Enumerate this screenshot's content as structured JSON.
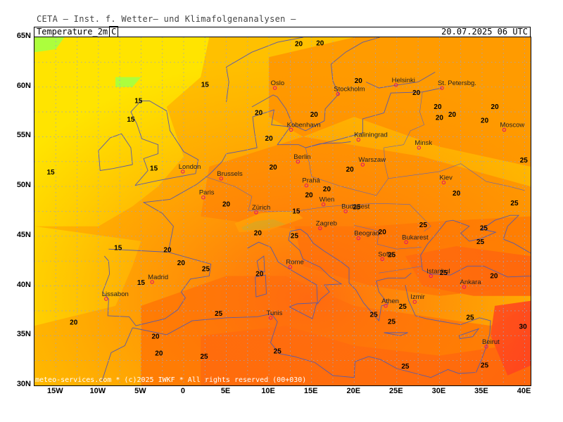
{
  "top_title": "CETA — Inst. f. Wetter— und Klimafolgenanalysen —",
  "header": {
    "field": "Temperature_2m",
    "unit": "C",
    "datetime": "20.07.2025 06 UTC"
  },
  "credit": "meteo-services.com * (c)2025 IWKF * All rights reserved (00+030)",
  "lat_labels": [
    "65N",
    "60N",
    "55N",
    "50N",
    "45N",
    "40N",
    "35N",
    "30N"
  ],
  "lon_labels": [
    "15W",
    "10W",
    "5W",
    "0",
    "5E",
    "10E",
    "15E",
    "20E",
    "25E",
    "30E",
    "35E",
    "40E"
  ],
  "colors": {
    "cool": "#ffe600",
    "mild": "#ffc000",
    "warm": "#ff9900",
    "hot": "#ff7a00",
    "hotter": "#ff5a10",
    "very_hot": "#ff2a2a",
    "green": "#a8ff40"
  },
  "cities": [
    {
      "name": "Oslo",
      "lon": 10.7,
      "lat": 59.9
    },
    {
      "name": "Stockholm",
      "lon": 18.1,
      "lat": 59.3
    },
    {
      "name": "Helsinki",
      "lon": 24.9,
      "lat": 60.2
    },
    {
      "name": "St. Petersbg.",
      "lon": 30.3,
      "lat": 59.9
    },
    {
      "name": "Kobenhavn",
      "lon": 12.6,
      "lat": 55.7
    },
    {
      "name": "Kaliningrad",
      "lon": 20.5,
      "lat": 54.7
    },
    {
      "name": "Minsk",
      "lon": 27.6,
      "lat": 53.9
    },
    {
      "name": "Moscow",
      "lon": 37.6,
      "lat": 55.7
    },
    {
      "name": "London",
      "lon": -0.1,
      "lat": 51.5
    },
    {
      "name": "Brussels",
      "lon": 4.4,
      "lat": 50.8
    },
    {
      "name": "Berlin",
      "lon": 13.4,
      "lat": 52.5
    },
    {
      "name": "Warszaw",
      "lon": 21.0,
      "lat": 52.2
    },
    {
      "name": "Paris",
      "lon": 2.3,
      "lat": 48.9
    },
    {
      "name": "Prahá",
      "lon": 14.4,
      "lat": 50.1
    },
    {
      "name": "Kiev",
      "lon": 30.5,
      "lat": 50.4
    },
    {
      "name": "Wien",
      "lon": 16.4,
      "lat": 48.2
    },
    {
      "name": "Zürich",
      "lon": 8.5,
      "lat": 47.4
    },
    {
      "name": "Budapest",
      "lon": 19.0,
      "lat": 47.5
    },
    {
      "name": "Zagreb",
      "lon": 16.0,
      "lat": 45.8
    },
    {
      "name": "Beograd",
      "lon": 20.5,
      "lat": 44.8
    },
    {
      "name": "Bukarest",
      "lon": 26.1,
      "lat": 44.4
    },
    {
      "name": "Sofia",
      "lon": 23.3,
      "lat": 42.7
    },
    {
      "name": "Rome",
      "lon": 12.5,
      "lat": 41.9
    },
    {
      "name": "Madrid",
      "lon": -3.7,
      "lat": 40.4
    },
    {
      "name": "Lissabon",
      "lon": -9.1,
      "lat": 38.7
    },
    {
      "name": "Istanbul",
      "lon": 29.0,
      "lat": 41.0
    },
    {
      "name": "Ankara",
      "lon": 32.9,
      "lat": 39.9
    },
    {
      "name": "Athen",
      "lon": 23.7,
      "lat": 38.0
    },
    {
      "name": "Izmir",
      "lon": 27.1,
      "lat": 38.4
    },
    {
      "name": "Tunis",
      "lon": 10.2,
      "lat": 36.8
    },
    {
      "name": "Beirut",
      "lon": 35.5,
      "lat": 33.9
    }
  ],
  "contour_labels": [
    {
      "text": "20",
      "lon": 13.5,
      "lat": 64.1
    },
    {
      "text": "20",
      "lon": 16.0,
      "lat": 64.2
    },
    {
      "text": "15",
      "lon": 2.5,
      "lat": 60.0
    },
    {
      "text": "20",
      "lon": 20.5,
      "lat": 60.4
    },
    {
      "text": "20",
      "lon": 27.3,
      "lat": 59.2
    },
    {
      "text": "20",
      "lon": 29.8,
      "lat": 57.8
    },
    {
      "text": "20",
      "lon": 31.5,
      "lat": 57.0
    },
    {
      "text": "20",
      "lon": 36.5,
      "lat": 57.8
    },
    {
      "text": "15",
      "lon": -5.3,
      "lat": 58.4
    },
    {
      "text": "15",
      "lon": -6.2,
      "lat": 56.5
    },
    {
      "text": "20",
      "lon": 8.8,
      "lat": 57.2
    },
    {
      "text": "20",
      "lon": 15.3,
      "lat": 57.0
    },
    {
      "text": "20",
      "lon": 10.0,
      "lat": 54.6
    },
    {
      "text": "20",
      "lon": 30.0,
      "lat": 56.7
    },
    {
      "text": "20",
      "lon": 35.3,
      "lat": 56.4
    },
    {
      "text": "25",
      "lon": 39.9,
      "lat": 52.4
    },
    {
      "text": "15",
      "lon": -15.6,
      "lat": 51.2
    },
    {
      "text": "15",
      "lon": -3.5,
      "lat": 51.6
    },
    {
      "text": "20",
      "lon": 10.5,
      "lat": 51.7
    },
    {
      "text": "20",
      "lon": 19.5,
      "lat": 51.5
    },
    {
      "text": "20",
      "lon": 16.8,
      "lat": 49.5
    },
    {
      "text": "20",
      "lon": 14.7,
      "lat": 48.9
    },
    {
      "text": "20",
      "lon": 32.0,
      "lat": 49.1
    },
    {
      "text": "20",
      "lon": 5.0,
      "lat": 48.0
    },
    {
      "text": "25",
      "lon": 20.3,
      "lat": 47.7
    },
    {
      "text": "25",
      "lon": 38.8,
      "lat": 48.1
    },
    {
      "text": "15",
      "lon": 13.2,
      "lat": 47.3
    },
    {
      "text": "25",
      "lon": 28.1,
      "lat": 45.9
    },
    {
      "text": "25",
      "lon": 35.2,
      "lat": 45.6
    },
    {
      "text": "20",
      "lon": 8.7,
      "lat": 45.1
    },
    {
      "text": "25",
      "lon": 13.0,
      "lat": 44.8
    },
    {
      "text": "20",
      "lon": 23.3,
      "lat": 45.2
    },
    {
      "text": "25",
      "lon": 34.8,
      "lat": 44.2
    },
    {
      "text": "15",
      "lon": -7.7,
      "lat": 43.6
    },
    {
      "text": "20",
      "lon": -1.9,
      "lat": 43.4
    },
    {
      "text": "20",
      "lon": -0.3,
      "lat": 42.1
    },
    {
      "text": "25",
      "lon": 2.6,
      "lat": 41.5
    },
    {
      "text": "20",
      "lon": 8.9,
      "lat": 41.0
    },
    {
      "text": "25",
      "lon": 24.4,
      "lat": 42.9
    },
    {
      "text": "25",
      "lon": 30.5,
      "lat": 41.1
    },
    {
      "text": "20",
      "lon": 36.4,
      "lat": 40.8
    },
    {
      "text": "15",
      "lon": -5.0,
      "lat": 40.1
    },
    {
      "text": "25",
      "lon": 4.1,
      "lat": 37.0
    },
    {
      "text": "25",
      "lon": 22.3,
      "lat": 36.9
    },
    {
      "text": "25",
      "lon": 25.7,
      "lat": 37.7
    },
    {
      "text": "25",
      "lon": 24.4,
      "lat": 36.2
    },
    {
      "text": "25",
      "lon": 33.6,
      "lat": 36.6
    },
    {
      "text": "30",
      "lon": 39.8,
      "lat": 35.7
    },
    {
      "text": "20",
      "lon": -12.9,
      "lat": 36.1
    },
    {
      "text": "20",
      "lon": -3.3,
      "lat": 34.7
    },
    {
      "text": "20",
      "lon": -2.9,
      "lat": 33.0
    },
    {
      "text": "25",
      "lon": 2.4,
      "lat": 32.7
    },
    {
      "text": "25",
      "lon": 11.0,
      "lat": 33.2
    },
    {
      "text": "25",
      "lon": 26.0,
      "lat": 31.7
    },
    {
      "text": "25",
      "lon": 35.3,
      "lat": 31.8
    }
  ]
}
